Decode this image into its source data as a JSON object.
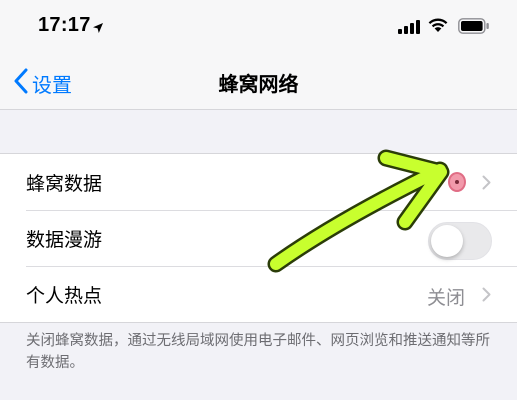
{
  "status_bar": {
    "time": "17:17",
    "icons": [
      "location-icon",
      "signal-icon",
      "wifi-icon",
      "battery-icon"
    ]
  },
  "nav": {
    "back_label": "设置",
    "title": "蜂窝网络"
  },
  "settings": {
    "rows": [
      {
        "label": "蜂窝数据",
        "type": "disclosure"
      },
      {
        "label": "数据漫游",
        "type": "toggle",
        "on": false
      },
      {
        "label": "个人热点",
        "type": "disclosure",
        "value": "关闭"
      }
    ],
    "footnote": "关闭蜂窝数据，通过无线局域网使用电子邮件、网页浏览和推送通知等所有数据。"
  },
  "colors": {
    "accent": "#007aff",
    "annotation": "#c8ff2e",
    "annotation_outline": "#2b3d08"
  }
}
